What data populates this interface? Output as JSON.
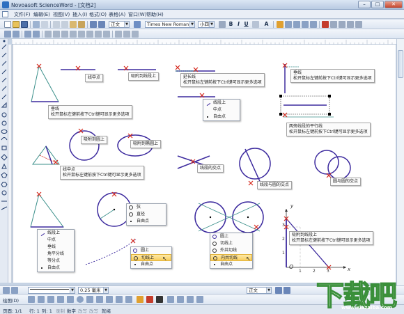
{
  "window": {
    "title": "Novoasoft ScienceWord - [文档2]",
    "min": "–",
    "max": "□",
    "close": "✕"
  },
  "menu": [
    "文件(F)",
    "编辑(E)",
    "视图(V)",
    "插入(I)",
    "格式(O)",
    "表格(A)",
    "窗口(W)",
    "帮助(H)"
  ],
  "toolbar": {
    "style_value": "正文",
    "font_value": "Times New Roman",
    "size_value": "小四"
  },
  "canvas": {
    "tips": {
      "midpoint": "线中点",
      "snap_segment": "吸附到线段上",
      "extend_line": "延长线\n松开鼠标左键前按下Ctrl键可显示更多选项",
      "perpendicular_top": "垂线\n松开鼠标左键前按下Ctrl键可显示更多选项",
      "perpendicular_left": "垂线\n松开鼠标左键前按下Ctrl键可显示更多选项",
      "snap_circle": "吸附到圆上",
      "snap_ellipse": "吸附到椭圆上",
      "parallel": "两旁线段的平行线\n松开鼠标左键前按下Ctrl键可显示更多选项",
      "median": "线中点\n松开鼠标左键前按下Ctrl键可显示更多选项",
      "line_intersection": "线段的交点",
      "line_circle_intersection": "线段与圆的交点",
      "circle_intersection": "圆与圆的交点",
      "snap_segment_axis": "吸附到线段上\n松开鼠标左键前按下Ctrl键可显示更多选项"
    },
    "menus": {
      "segment_menu": [
        "线段上",
        "中点",
        "自由点"
      ],
      "triangle_menu": [
        "线段上",
        "中点",
        "垂线",
        "角平分线",
        "等分点",
        "自由点"
      ],
      "circle_menu": [
        "弦",
        "直径",
        "自由点"
      ],
      "tangent_menu": [
        "圆上",
        "切线上",
        "自由点"
      ],
      "two_circle_menu": [
        "圆上",
        "切线上",
        "外共切线",
        "内共切线",
        "自由点"
      ]
    },
    "axis": {
      "x_label": "x",
      "y_label": "y",
      "origin": "O",
      "x_ticks": [
        "1",
        "2",
        "3"
      ],
      "y_ticks": [
        "1",
        "2",
        "3"
      ]
    },
    "colors": {
      "line": "#3c2a9e",
      "figure": "#3a8f8a",
      "cross": "#d62a1f",
      "ctx_highlight": "#f8cd5c"
    }
  },
  "bottom_toolbar": {
    "line_width": "0.25 毫米",
    "style_value": "正文"
  },
  "drawing_toolbar": {
    "draw_label": "绘图(D)"
  },
  "status": {
    "page": "页面: 1/1",
    "row": "行: 1",
    "col": "列: 1",
    "rec": "录制",
    "mode_num": "数字",
    "ovr": "改写",
    "caps": "改写",
    "ready": "就绪"
  },
  "watermark": {
    "text": "下载吧",
    "url": "www.xiazaiba.com"
  }
}
